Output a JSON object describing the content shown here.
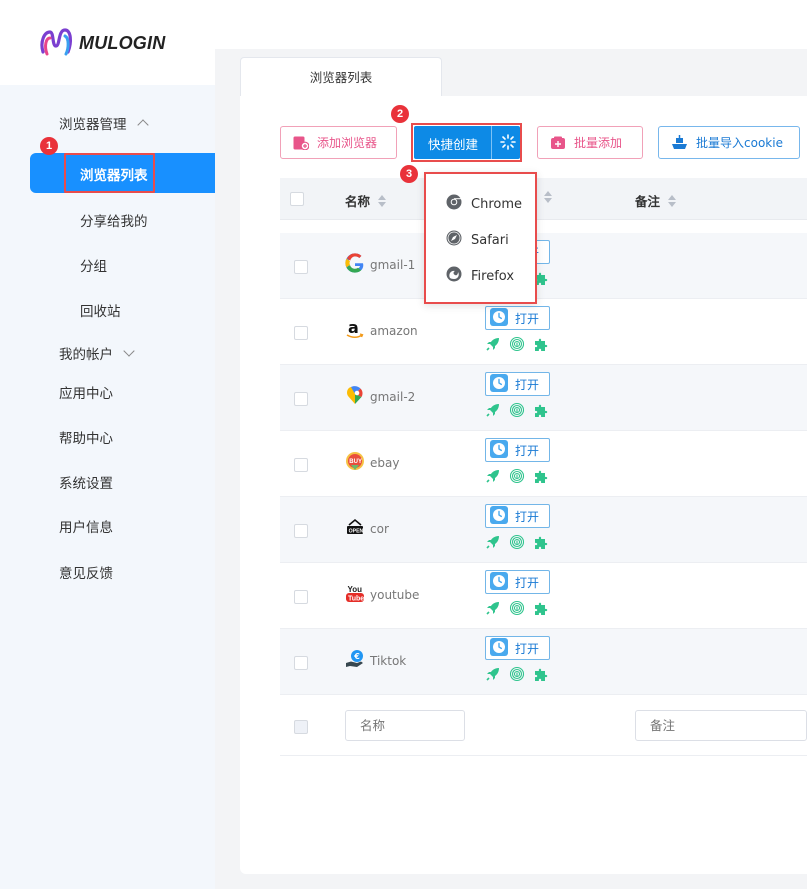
{
  "logo": {
    "text": "MULOGIN"
  },
  "sidebar": {
    "group_browser": "浏览器管理",
    "active_item": "浏览器列表",
    "sub_items": [
      "分享给我的",
      "分组",
      "回收站"
    ],
    "group_account": "我的帐户",
    "items": [
      "应用中心",
      "帮助中心",
      "系统设置",
      "用户信息",
      "意见反馈"
    ]
  },
  "steps": [
    "1",
    "2",
    "3"
  ],
  "tab": {
    "label": "浏览器列表"
  },
  "toolbar": {
    "add_browser": "添加浏览器",
    "quick_create": "快捷创建",
    "batch_add": "批量添加",
    "import_cookie": "批量导入cookie"
  },
  "dropdown": {
    "items": [
      "Chrome",
      "Safari",
      "Firefox"
    ]
  },
  "table": {
    "headers": {
      "name": "名称",
      "remark": "备注"
    },
    "open_label": "打开",
    "rows": [
      {
        "name": "gmail-1",
        "icon": "google-icon"
      },
      {
        "name": "amazon",
        "icon": "amazon-icon"
      },
      {
        "name": "gmail-2",
        "icon": "google-maps-icon"
      },
      {
        "name": "ebay",
        "icon": "buy-badge-icon"
      },
      {
        "name": "cor",
        "icon": "open-sign-icon"
      },
      {
        "name": "youtube",
        "icon": "youtube-icon"
      },
      {
        "name": "Tiktok",
        "icon": "euro-hand-icon"
      }
    ],
    "filter": {
      "name_placeholder": "名称",
      "remark_placeholder": "备注"
    }
  },
  "colors": {
    "primary": "#1890ff",
    "button_blue": "#0d8ae6",
    "pink": "#e8558a",
    "action_green": "#2fc48d",
    "highlight_red": "#e84c4c",
    "step_red": "#e9323a"
  }
}
